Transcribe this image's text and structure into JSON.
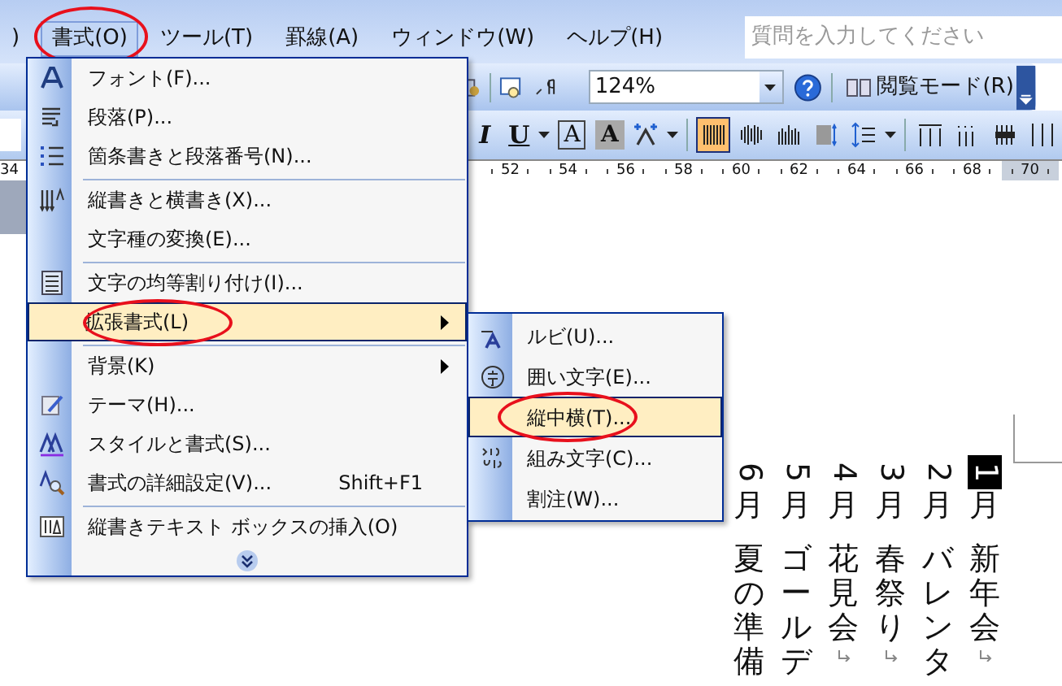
{
  "menu_bar": {
    "items": [
      {
        "label": ")",
        "selected": false,
        "circled": false
      },
      {
        "label": "書式(O)",
        "selected": true,
        "circled": true
      },
      {
        "label": "ツール(T)",
        "selected": false,
        "circled": false
      },
      {
        "label": "罫線(A)",
        "selected": false,
        "circled": false
      },
      {
        "label": "ウィンドウ(W)",
        "selected": false,
        "circled": false
      },
      {
        "label": "ヘルプ(H)",
        "selected": false,
        "circled": false
      }
    ],
    "search": {
      "placeholder": "質問を入力してください"
    }
  },
  "toolbar_standard": {
    "zoom": "124%",
    "reading_mode": "閲覧モード(R)"
  },
  "toolbar_formatting": {
    "items": [
      {
        "kind": "italic",
        "text": "I"
      },
      {
        "kind": "underline",
        "text": "U"
      },
      {
        "kind": "dropdown"
      },
      {
        "kind": "boxed",
        "text": "A"
      },
      {
        "kind": "shaded",
        "text": "A"
      },
      {
        "kind": "icon",
        "selected": false
      },
      {
        "kind": "dropdown"
      },
      {
        "kind": "separator"
      },
      {
        "kind": "icon",
        "selected": true
      },
      {
        "kind": "icon",
        "selected": false
      },
      {
        "kind": "icon",
        "selected": false
      },
      {
        "kind": "icon",
        "selected": false
      },
      {
        "kind": "icon",
        "selected": false
      },
      {
        "kind": "dropdown"
      },
      {
        "kind": "separator"
      },
      {
        "kind": "icon",
        "selected": false
      },
      {
        "kind": "icon",
        "selected": false
      },
      {
        "kind": "icon",
        "selected": false
      },
      {
        "kind": "icon",
        "selected": false
      }
    ]
  },
  "ruler": {
    "labels": [
      "34",
      "52",
      "54",
      "56",
      "58",
      "60",
      "62",
      "64",
      "66",
      "68",
      "70"
    ]
  },
  "format_menu": {
    "items": [
      {
        "label": "フォント(F)...",
        "separator_before": false,
        "selected": false,
        "circled": false,
        "submenu": false
      },
      {
        "label": "段落(P)...",
        "separator_before": false,
        "selected": false,
        "circled": false,
        "submenu": false
      },
      {
        "label": "箇条書きと段落番号(N)...",
        "separator_before": false,
        "selected": false,
        "circled": false,
        "submenu": false
      },
      {
        "label": "縦書きと横書き(X)...",
        "separator_before": true,
        "selected": false,
        "circled": false,
        "submenu": false
      },
      {
        "label": "文字種の変換(E)...",
        "separator_before": false,
        "selected": false,
        "circled": false,
        "submenu": false
      },
      {
        "label": "文字の均等割り付け(I)...",
        "separator_before": true,
        "selected": false,
        "circled": false,
        "submenu": false
      },
      {
        "label": "拡張書式(L)",
        "separator_before": false,
        "selected": true,
        "circled": true,
        "submenu": true
      },
      {
        "label": "背景(K)",
        "separator_before": true,
        "selected": false,
        "circled": false,
        "submenu": true
      },
      {
        "label": "テーマ(H)...",
        "separator_before": false,
        "selected": false,
        "circled": false,
        "submenu": false
      },
      {
        "label": "スタイルと書式(S)...",
        "separator_before": false,
        "selected": false,
        "circled": false,
        "submenu": false
      },
      {
        "label": "書式の詳細設定(V)...",
        "shortcut": "Shift+F1",
        "separator_before": false,
        "selected": false,
        "circled": false,
        "submenu": false
      },
      {
        "label": "縦書きテキスト ボックスの挿入(O)",
        "separator_before": true,
        "selected": false,
        "circled": false,
        "submenu": false
      }
    ]
  },
  "extended_menu": {
    "items": [
      {
        "label": "ルビ(U)...",
        "selected": false,
        "circled": false
      },
      {
        "label": "囲い文字(E)...",
        "selected": false,
        "circled": false
      },
      {
        "label": "縦中横(T)...",
        "selected": true,
        "circled": true
      },
      {
        "label": "組み文字(C)...",
        "selected": false,
        "circled": false
      },
      {
        "label": "割注(W)...",
        "selected": false,
        "circled": false
      }
    ]
  },
  "document": {
    "columns": [
      {
        "month": "6月",
        "event": "夏の準備",
        "highlighted": false,
        "paragraph_mark": false
      },
      {
        "month": "5月",
        "event": "ゴールデ",
        "highlighted": false,
        "paragraph_mark": false
      },
      {
        "month": "4月",
        "event": "花見会",
        "highlighted": false,
        "paragraph_mark": true
      },
      {
        "month": "3月",
        "event": "春祭り",
        "highlighted": false,
        "paragraph_mark": true
      },
      {
        "month": "2月",
        "event": "バレンタ",
        "highlighted": false,
        "paragraph_mark": false
      },
      {
        "month": "1月",
        "event": "新年会",
        "highlighted": true,
        "paragraph_mark": true
      }
    ]
  }
}
